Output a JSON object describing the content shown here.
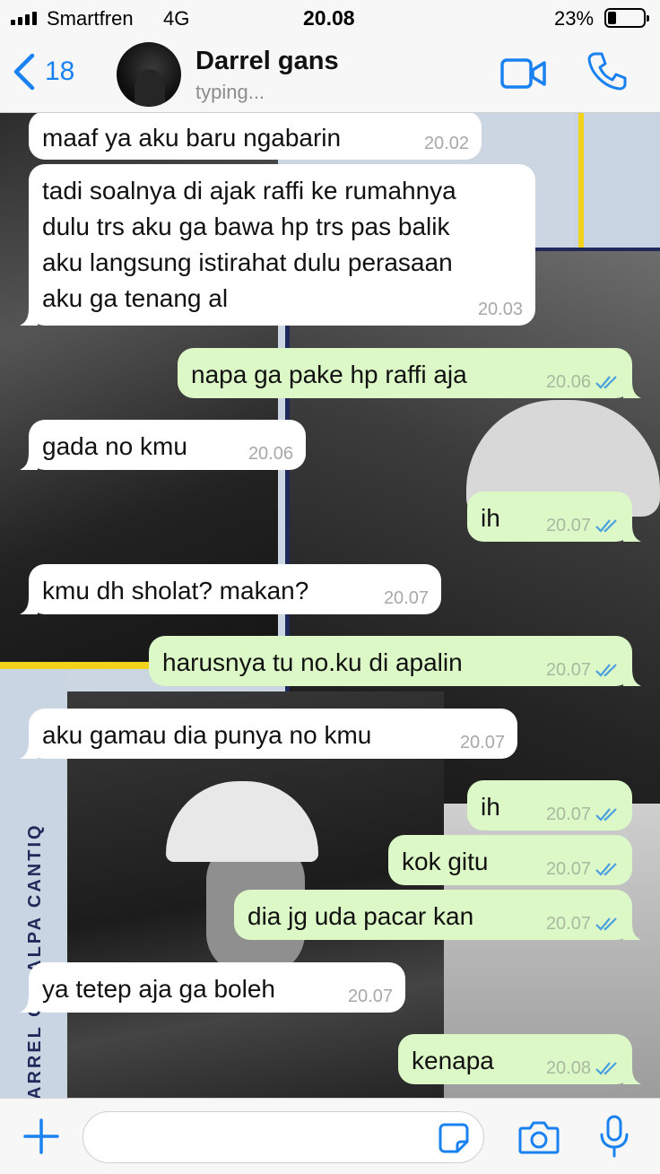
{
  "status_bar": {
    "carrier": "Smartfren",
    "network": "4G",
    "time": "20.08",
    "battery": "23%"
  },
  "header": {
    "back_count": "18",
    "contact_name": "Darrel gans",
    "contact_status": "typing..."
  },
  "background": {
    "vertical_text": "ARREL G x ALPA CANTIQ"
  },
  "messages": [
    {
      "dir": "in",
      "text": "maaf ya aku baru ngabarin",
      "time": "20.02"
    },
    {
      "dir": "in",
      "text": "tadi soalnya di ajak raffi ke rumahnya\ndulu trs aku ga bawa hp trs pas balik\naku langsung istirahat dulu perasaan\naku ga tenang al",
      "time": "20.03"
    },
    {
      "dir": "out",
      "text": "napa ga pake hp raffi aja",
      "time": "20.06"
    },
    {
      "dir": "in",
      "text": "gada no kmu",
      "time": "20.06"
    },
    {
      "dir": "out",
      "text": "ih",
      "time": "20.07"
    },
    {
      "dir": "in",
      "text": "kmu dh sholat? makan?",
      "time": "20.07"
    },
    {
      "dir": "out",
      "text": "harusnya tu no.ku di apalin",
      "time": "20.07"
    },
    {
      "dir": "in",
      "text": "aku gamau dia punya no kmu",
      "time": "20.07"
    },
    {
      "dir": "out",
      "text": "ih",
      "time": "20.07"
    },
    {
      "dir": "out",
      "text": "kok gitu",
      "time": "20.07"
    },
    {
      "dir": "out",
      "text": "dia jg uda pacar kan",
      "time": "20.07"
    },
    {
      "dir": "in",
      "text": "ya tetep aja ga boleh",
      "time": "20.07"
    },
    {
      "dir": "out",
      "text": "kenapa",
      "time": "20.08"
    }
  ],
  "colors": {
    "accent": "#1a82f0",
    "incoming_bubble": "#ffffff",
    "outgoing_bubble": "#dcf8c6",
    "read_ticks": "#4a9fe0"
  },
  "icons": [
    "back-chevron-icon",
    "video-call-icon",
    "phone-call-icon",
    "plus-icon",
    "sticker-icon",
    "camera-icon",
    "microphone-icon",
    "read-ticks-icon"
  ]
}
